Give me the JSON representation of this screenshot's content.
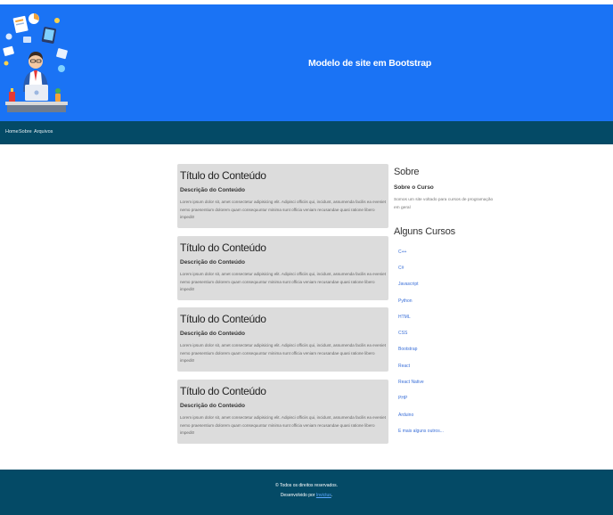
{
  "header": {
    "title": "Modelo de site em Bootstrap",
    "illustration_icon": "developer-at-laptop-illustration"
  },
  "nav": {
    "items": [
      {
        "label": "Home"
      },
      {
        "label": "Sobre"
      },
      {
        "label": "Arquivos"
      }
    ]
  },
  "posts": [
    {
      "title": "Título do Conteúdo",
      "subtitle": "Descrição do Conteúdo",
      "body": "Lorem ipsum dolor sit, amet consectetur adipisicing elit. Adipisci officiis qui, incidunt, assumenda facilis ea eveniet nemo praesentium dolorem quam consequuntur minima sunt officia veniam recusandae quasi ratione libero impedit!"
    },
    {
      "title": "Título do Conteúdo",
      "subtitle": "Descrição do Conteúdo",
      "body": "Lorem ipsum dolor sit, amet consectetur adipisicing elit. Adipisci officiis qui, incidunt, assumenda facilis ea eveniet nemo praesentium dolorem quam consequuntur minima sunt officia veniam recusandae quasi ratione libero impedit!"
    },
    {
      "title": "Título do Conteúdo",
      "subtitle": "Descrição do Conteúdo",
      "body": "Lorem ipsum dolor sit, amet consectetur adipisicing elit. Adipisci officiis qui, incidunt, assumenda facilis ea eveniet nemo praesentium dolorem quam consequuntur minima sunt officia veniam recusandae quasi ratione libero impedit!"
    },
    {
      "title": "Título do Conteúdo",
      "subtitle": "Descrição do Conteúdo",
      "body": "Lorem ipsum dolor sit, amet consectetur adipisicing elit. Adipisci officiis qui, incidunt, assumenda facilis ea eveniet nemo praesentium dolorem quam consequuntur minima sunt officia veniam recusandae quasi ratione libero impedit!"
    }
  ],
  "sidebar": {
    "about_heading": "Sobre",
    "about_subheading": "Sobre o Curso",
    "about_text": "Somos um site voltado para cursos de programação em geral",
    "courses_heading": "Alguns Cursos",
    "courses": [
      {
        "label": "C++"
      },
      {
        "label": "C#"
      },
      {
        "label": "Javascript"
      },
      {
        "label": "Python"
      },
      {
        "label": "HTML"
      },
      {
        "label": "CSS"
      },
      {
        "label": "Bootstrap"
      },
      {
        "label": "React"
      },
      {
        "label": "React Native"
      },
      {
        "label": "PHP"
      },
      {
        "label": "Arduino"
      },
      {
        "label": "E mais alguns outros..."
      }
    ]
  },
  "footer": {
    "rights": "© Todos os direitos reservados.",
    "developed_by": "Desenvolvido por",
    "author_link": "Invictus",
    "suffix": "."
  },
  "colors": {
    "hero_bg": "#1a73f5",
    "nav_bg": "#044a66",
    "card_bg": "#dcdcdc",
    "link": "#3a6fd8"
  }
}
